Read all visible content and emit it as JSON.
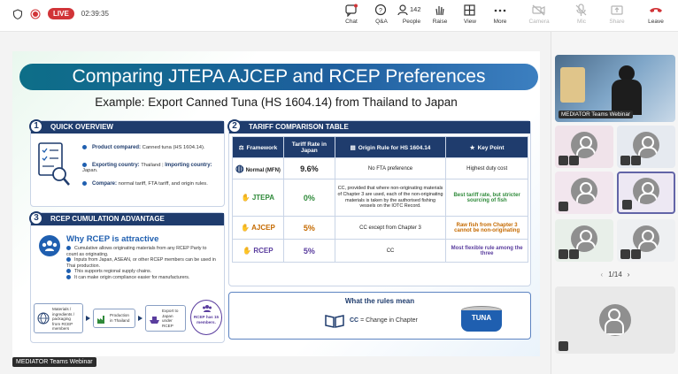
{
  "meeting": {
    "live_label": "LIVE",
    "timer": "02:39:35"
  },
  "controls": [
    {
      "label": "Chat",
      "icon": "chat-icon",
      "disabled": false
    },
    {
      "label": "Q&A",
      "icon": "qna-icon",
      "disabled": false
    },
    {
      "label": "People",
      "icon": "people-icon",
      "count": "142",
      "disabled": false
    },
    {
      "label": "Raise",
      "icon": "raise-hand-icon",
      "disabled": false
    },
    {
      "label": "View",
      "icon": "view-icon",
      "disabled": false
    },
    {
      "label": "More",
      "icon": "more-icon",
      "disabled": false
    },
    {
      "label": "Camera",
      "icon": "camera-icon",
      "disabled": true
    },
    {
      "label": "Mic",
      "icon": "mic-icon",
      "disabled": true
    },
    {
      "label": "Share",
      "icon": "share-icon",
      "disabled": true
    },
    {
      "label": "Leave",
      "icon": "leave-icon",
      "disabled": false
    }
  ],
  "slide": {
    "title": "Comparing JTEPA AJCEP and RCEP Preferences",
    "subtitle": "Example: Export Canned Tuna (HS 1604.14) from Thailand to Japan",
    "quick_overview": {
      "num": "1",
      "title": "QUICK OVERVIEW",
      "product_label": "Product compared:",
      "product_value": "Canned tuna (HS 1604.14).",
      "exporting_label": "Exporting country:",
      "exporting_value": "Thailand",
      "sep": "|",
      "importing_label": "Importing country:",
      "importing_value": "Japan.",
      "compare_label": "Compare:",
      "compare_value": "normal tariff, FTA tariff, and origin rules."
    },
    "tariff_table": {
      "num": "2",
      "title": "TARIFF COMPARISON TABLE",
      "headers": [
        "Framework",
        "Tariff Rate in Japan",
        "Origin Rule for HS 1604.14",
        "Key Point"
      ],
      "rows": [
        {
          "framework": "Normal (MFN)",
          "rate": "9.6%",
          "rule": "No FTA preference",
          "key": "Highest duty cost"
        },
        {
          "framework": "JTEPA",
          "rate": "0%",
          "rule": "CC, provided that where non-originating materials of Chapter 3 are used, each of the non-originating materials is taken by the authorised fishing vessels on the IOTC Record.",
          "key": "Best tariff rate, but stricter sourcing of fish"
        },
        {
          "framework": "AJCEP",
          "rate": "5%",
          "rule": "CC except from Chapter 3",
          "key": "Raw fish from Chapter 3 cannot be non-originating"
        },
        {
          "framework": "RCEP",
          "rate": "5%",
          "rule": "CC",
          "key": "Most flexible rule among the three"
        }
      ]
    },
    "cumulation": {
      "num": "3",
      "title": "RCEP CUMULATION ADVANTAGE",
      "why": "Why RCEP is attractive",
      "points": [
        "Cumulative allows originating materials from any RCEP Party to count as originating.",
        "Inputs from Japan, ASEAN, or other RCEP members can be used in Thai production.",
        "This supports regional supply chains.",
        "It can make origin compliance easier for manufacturers."
      ],
      "flow": [
        "Materials / ingredients / packaging from RCEP members",
        "Production in Thailand",
        "Export to Japan under RCEP",
        "RCEP has 15 members."
      ]
    },
    "rules_mean": {
      "title": "What the rules mean",
      "cc_label": "CC",
      "cc_text": "= Change in Chapter",
      "can_label": "TUNA"
    }
  },
  "sidebar": {
    "presenter_label": "MEDIATOR Teams Webinar",
    "page_indicator": "1/14"
  },
  "bottom_label": "MEDIATOR Teams Webinar"
}
